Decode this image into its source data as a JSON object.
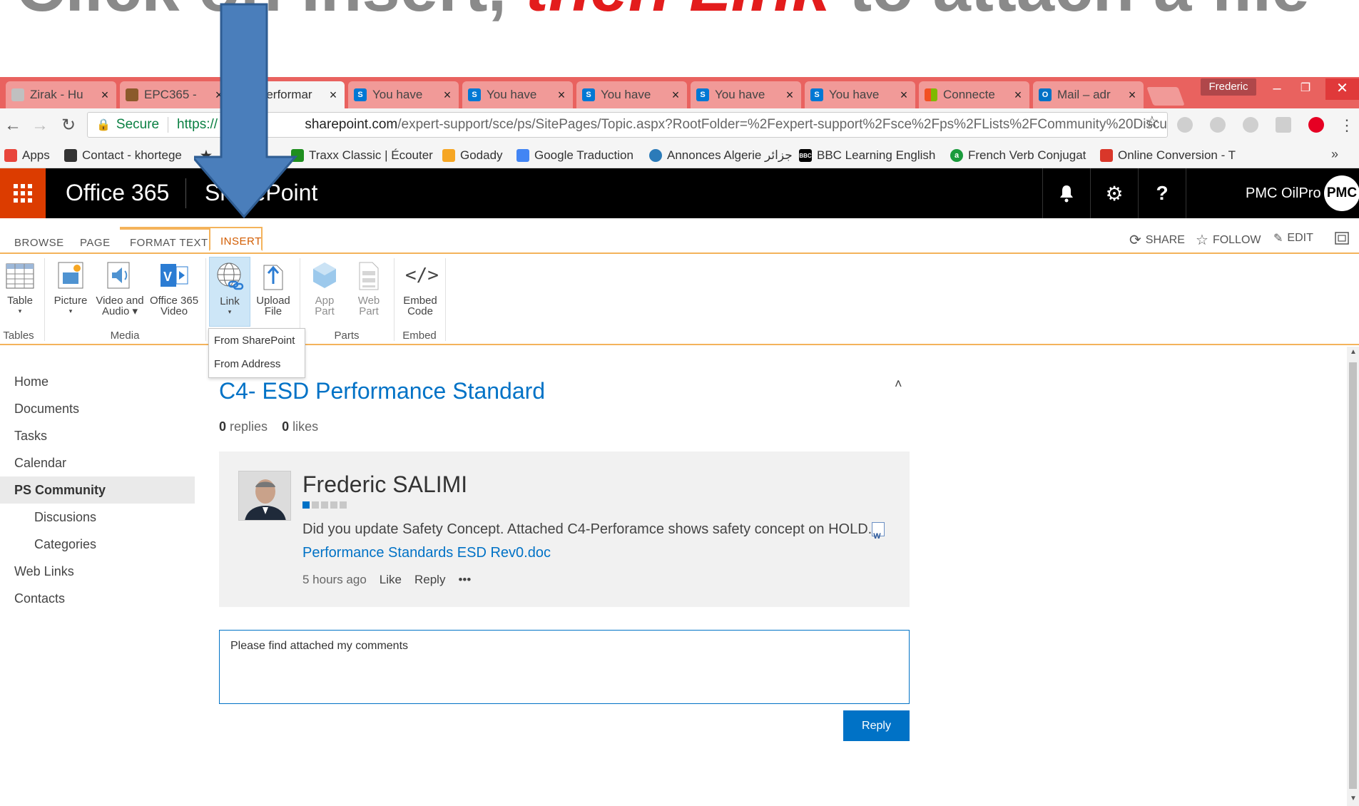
{
  "headline": {
    "before": "Click on Insert,",
    "highlight": " then Link ",
    "after": "to attach a file"
  },
  "browser": {
    "tabs": [
      {
        "label": "Zirak - Hu",
        "favicon_color": "#c0c0c0"
      },
      {
        "label": "EPC365 -",
        "favicon_color": "#8b5a2b"
      },
      {
        "label": "Performar",
        "favicon_color": "#0078d4"
      },
      {
        "label": "You have",
        "favicon_color": "#0078d4"
      },
      {
        "label": "You have",
        "favicon_color": "#0078d4"
      },
      {
        "label": "You have",
        "favicon_color": "#0078d4"
      },
      {
        "label": "You have",
        "favicon_color": "#0078d4"
      },
      {
        "label": "You have",
        "favicon_color": "#0078d4"
      },
      {
        "label": "Connecte",
        "favicon_color": "#f25022"
      },
      {
        "label": "Mail – adr",
        "favicon_color": "#0072c6"
      }
    ],
    "profile": "Frederic",
    "address": {
      "secure_label": "Secure",
      "scheme": "https://",
      "host": "sharepoint.com",
      "path": "/expert-support/sce/ps/SitePages/Topic.aspx?RootFolder=%2Fexpert-support%2Fsce%2Fps%2FLists%2FCommunity%20Discu"
    },
    "bookmarks": [
      {
        "label": "Apps",
        "icon": "apps-icon",
        "color": "#e8453c"
      },
      {
        "label": "Contact - khortege",
        "icon": "contact-icon",
        "color": "#333333"
      },
      {
        "label": "ks",
        "icon": "star-icon",
        "color": "#333333"
      },
      {
        "label": "Traxx Classic | Écouter",
        "icon": "traxx-icon",
        "color": "#1f8f1f"
      },
      {
        "label": "Godady",
        "icon": "godaddy-icon",
        "color": "#f6a623"
      },
      {
        "label": "Google Traduction",
        "icon": "translate-icon",
        "color": "#4285f4"
      },
      {
        "label": "Annonces Algerie جزائر",
        "icon": "annonces-icon",
        "color": "#2b7bb9"
      },
      {
        "label": "BBC Learning English",
        "icon": "bbc-icon",
        "color": "#000000"
      },
      {
        "label": "French Verb Conjugat",
        "icon": "verb-icon",
        "color": "#1a9b3c"
      },
      {
        "label": "Online Conversion - T",
        "icon": "conversion-icon",
        "color": "#d9372a"
      }
    ]
  },
  "suite": {
    "brand": "Office 365",
    "app": "SharePoint",
    "user": "PMC OilPro",
    "user_initials": "PMC"
  },
  "ribbon": {
    "tabs": [
      "BROWSE",
      "PAGE",
      "FORMAT TEXT",
      "INSERT"
    ],
    "actions": {
      "share": "SHARE",
      "follow": "FOLLOW",
      "edit": "EDIT"
    },
    "buttons": {
      "table": "Table",
      "picture": "Picture",
      "video_audio_1": "Video and",
      "video_audio_2": "Audio",
      "o365video_1": "Office 365",
      "o365video_2": "Video",
      "link": "Link",
      "upload_1": "Upload",
      "upload_2": "File",
      "apppart_1": "App",
      "apppart_2": "Part",
      "webpart_1": "Web",
      "webpart_2": "Part",
      "embed_1": "Embed",
      "embed_2": "Code"
    },
    "groups": {
      "tables": "Tables",
      "media": "Media",
      "parts": "Parts",
      "embed": "Embed"
    },
    "link_menu": [
      "From SharePoint",
      "From Address"
    ]
  },
  "nav": {
    "items": [
      "Home",
      "Documents",
      "Tasks",
      "Calendar",
      "PS Community",
      "Discusions",
      "Categories",
      "Web Links",
      "Contacts"
    ]
  },
  "topic": {
    "title": "C4- ESD Performance Standard",
    "replies_count": "0",
    "replies_label": "replies",
    "likes_count": "0",
    "likes_label": "likes"
  },
  "post": {
    "author": "Frederic SALIMI",
    "body": "Did you update Safety Concept. Attached C4-Perforamce shows safety concept on HOLD.",
    "attachment": "Performance Standards ESD Rev0.doc",
    "time": "5 hours ago",
    "like": "Like",
    "reply": "Reply",
    "more": "•••"
  },
  "reply_box": {
    "value": "Please find attached my comments",
    "button": "Reply"
  }
}
